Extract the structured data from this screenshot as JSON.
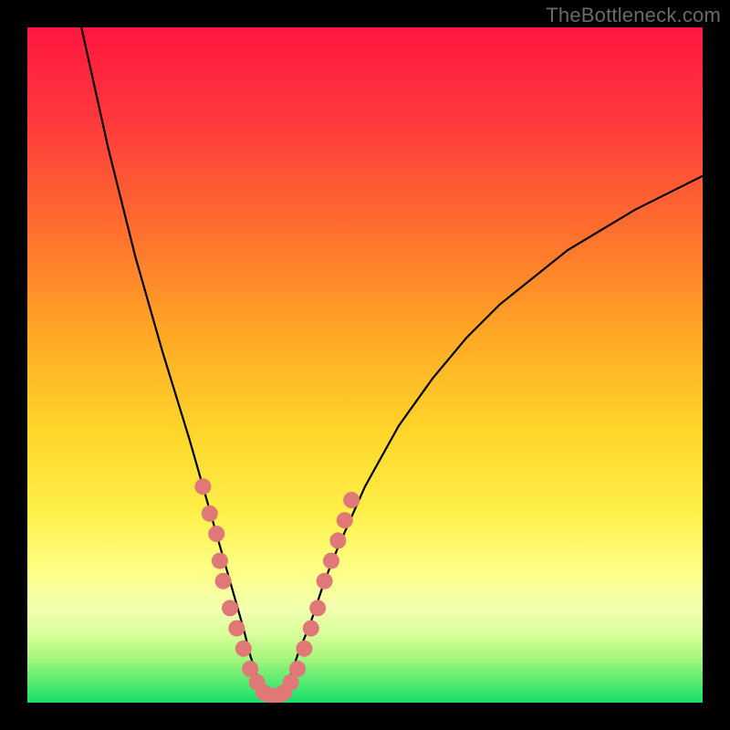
{
  "watermark": "TheBottleneck.com",
  "colors": {
    "background": "#000000",
    "gradient_top": "#ff2b46",
    "gradient_mid1": "#ff8a2b",
    "gradient_mid2": "#ffde2b",
    "gradient_mid3": "#fdfd7a",
    "gradient_low": "#c8ff7a",
    "gradient_bottom": "#16e06a",
    "curve": "#000000",
    "marker": "#e07878"
  },
  "chart_data": {
    "type": "line",
    "title": "",
    "xlabel": "",
    "ylabel": "",
    "xlim": [
      0,
      100
    ],
    "ylim": [
      0,
      100
    ],
    "series": [
      {
        "name": "bottleneck-curve",
        "x": [
          8,
          12,
          16,
          20,
          24,
          26,
          28,
          30,
          32,
          33,
          34,
          35,
          36,
          37,
          38,
          39,
          40,
          42,
          44,
          46,
          50,
          55,
          60,
          65,
          70,
          80,
          90,
          100
        ],
        "y": [
          100,
          82,
          66,
          52,
          39,
          32,
          25,
          18,
          11,
          7,
          4,
          2,
          1,
          1,
          2,
          4,
          7,
          12,
          18,
          23,
          32,
          41,
          48,
          54,
          59,
          67,
          73,
          78
        ]
      }
    ],
    "markers": [
      {
        "x": 26,
        "y": 32
      },
      {
        "x": 27,
        "y": 28
      },
      {
        "x": 28,
        "y": 25
      },
      {
        "x": 28.5,
        "y": 21
      },
      {
        "x": 29,
        "y": 18
      },
      {
        "x": 30,
        "y": 14
      },
      {
        "x": 31,
        "y": 11
      },
      {
        "x": 32,
        "y": 8
      },
      {
        "x": 33,
        "y": 5
      },
      {
        "x": 34,
        "y": 3
      },
      {
        "x": 35,
        "y": 1.5
      },
      {
        "x": 36,
        "y": 1
      },
      {
        "x": 37,
        "y": 1
      },
      {
        "x": 38,
        "y": 1.5
      },
      {
        "x": 39,
        "y": 3
      },
      {
        "x": 40,
        "y": 5
      },
      {
        "x": 41,
        "y": 8
      },
      {
        "x": 42,
        "y": 11
      },
      {
        "x": 43,
        "y": 14
      },
      {
        "x": 44,
        "y": 18
      },
      {
        "x": 45,
        "y": 21
      },
      {
        "x": 46,
        "y": 24
      },
      {
        "x": 47,
        "y": 27
      },
      {
        "x": 48,
        "y": 30
      }
    ]
  }
}
